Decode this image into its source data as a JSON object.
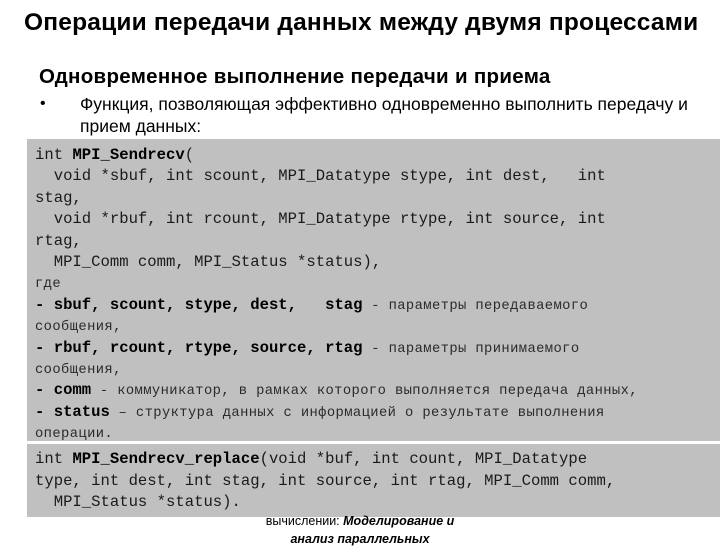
{
  "slide": {
    "title": "Операции передачи данных между двумя процессами",
    "subtitle": "Одновременное выполнение передачи и приема",
    "bullet": {
      "glyph": "•",
      "text": "Функция, позволяющая эффективно одновременно выполнить передачу и прием данных:"
    }
  },
  "code_block_1": {
    "lines": [
      [
        {
          "t": "int ",
          "s": "n"
        },
        {
          "t": "MPI_Sendrecv",
          "s": "b"
        },
        {
          "t": "(",
          "s": "n"
        }
      ],
      [
        {
          "t": "  void *sbuf, int scount, MPI_Datatype stype, int dest,   int",
          "s": "n"
        }
      ],
      [
        {
          "t": "stag,",
          "s": "n"
        }
      ],
      [
        {
          "t": "  void *rbuf, int rcount, MPI_Datatype rtype, int source, int",
          "s": "n"
        }
      ],
      [
        {
          "t": "rtag,",
          "s": "n"
        }
      ],
      [
        {
          "t": "  MPI_Comm comm, MPI_Status *status),",
          "s": "n"
        }
      ],
      [
        {
          "t": "где",
          "s": "d"
        }
      ],
      [
        {
          "t": "- sbuf, scount, stype, dest,   stag",
          "s": "b"
        },
        {
          "t": " - параметры передаваемого",
          "s": "d"
        }
      ],
      [
        {
          "t": "сообщения,",
          "s": "d"
        }
      ],
      [
        {
          "t": "- rbuf, rcount, rtype, source, rtag",
          "s": "b"
        },
        {
          "t": " - параметры принимаемого",
          "s": "d"
        }
      ],
      [
        {
          "t": "сообщения,",
          "s": "d"
        }
      ],
      [
        {
          "t": "- comm",
          "s": "b"
        },
        {
          "t": " - коммуникатор, в рамках которого выполняется передача данных,",
          "s": "d"
        }
      ],
      [
        {
          "t": "- status",
          "s": "b"
        },
        {
          "t": " – структура данных с информацией о результате выполнения",
          "s": "d"
        }
      ],
      [
        {
          "t": "операции.",
          "s": "d"
        }
      ]
    ]
  },
  "code_block_2": {
    "lines": [
      [
        {
          "t": "int ",
          "s": "n"
        },
        {
          "t": "MPI_Sendrecv_replace",
          "s": "b"
        },
        {
          "t": "(void *buf, int count, MPI_Datatype",
          "s": "n"
        }
      ],
      [
        {
          "t": "type, int dest, int stag, int source, int rtag, MPI_Comm comm,",
          "s": "n"
        }
      ],
      [
        {
          "t": "  MPI_Status *status).",
          "s": "n"
        }
      ]
    ]
  },
  "footer": {
    "line1_regular": "вычислении: ",
    "line1_bold_italic": "Моделирование и",
    "line2_bold_italic": "анализ параллельных"
  },
  "colors": {
    "code_background": "#c0c0c0",
    "text": "#000000",
    "background": "#ffffff"
  }
}
